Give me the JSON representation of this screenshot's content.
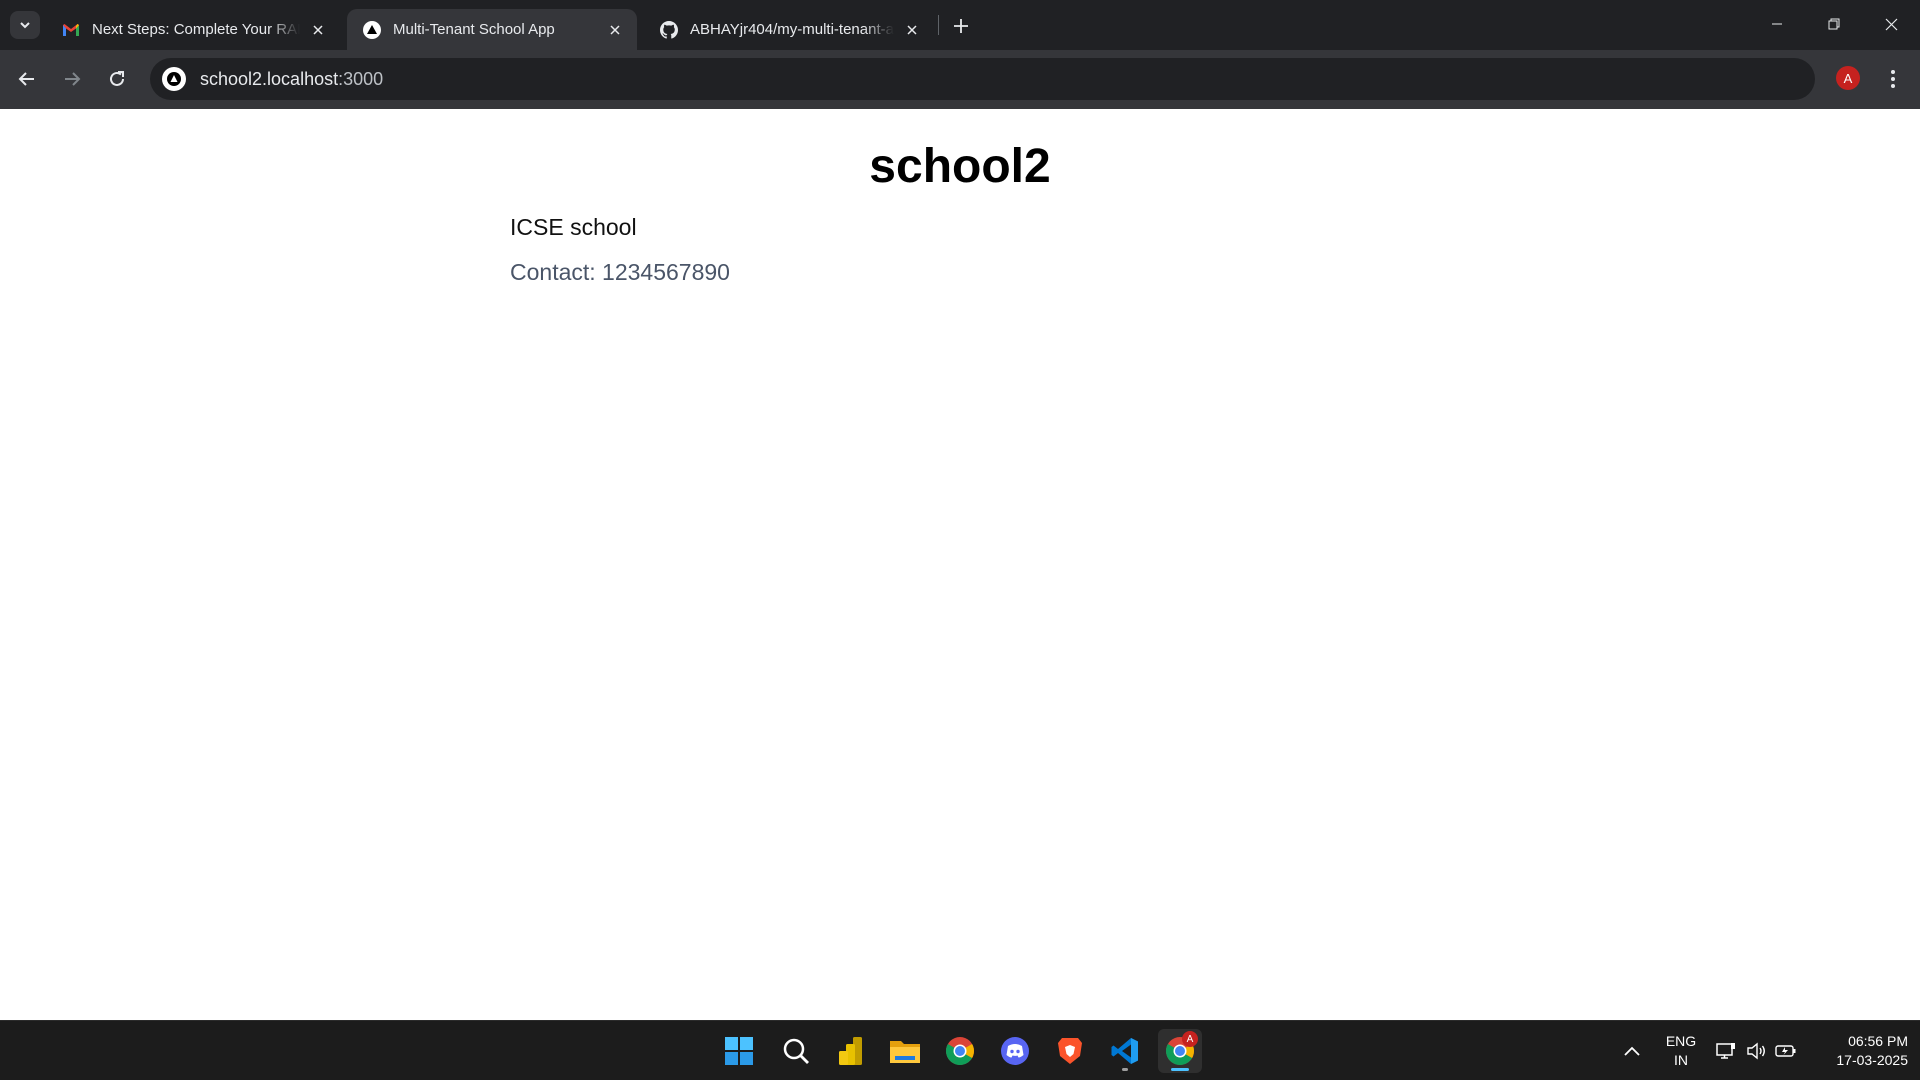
{
  "browser": {
    "tabs": [
      {
        "title": "Next Steps: Complete Your RAR",
        "icon": "gmail-icon",
        "active": false
      },
      {
        "title": "Multi-Tenant School App",
        "icon": "triangle-logo-icon",
        "active": true
      },
      {
        "title": "ABHAYjr404/my-multi-tenant-a",
        "icon": "github-icon",
        "active": false
      }
    ],
    "address": {
      "host": "school2.localhost",
      "port": ":3000"
    },
    "profile_initial": "A"
  },
  "page": {
    "title": "school2",
    "description": "ICSE school",
    "contact": "Contact: 1234567890"
  },
  "taskbar": {
    "apps": [
      "windows-start-icon",
      "search-icon",
      "power-bi-icon",
      "file-explorer-icon",
      "chrome-icon",
      "discord-icon",
      "brave-icon",
      "vscode-icon",
      "chrome-profile-icon"
    ],
    "language": "ENG",
    "region": "IN",
    "time": "06:56 PM",
    "date": "17-03-2025",
    "chrome_badge": "A"
  },
  "colors": {
    "tabstrip_bg": "#202124",
    "toolbar_bg": "#35363a",
    "taskbar_bg": "#1c1c1c",
    "contact_text": "#4a5568"
  }
}
